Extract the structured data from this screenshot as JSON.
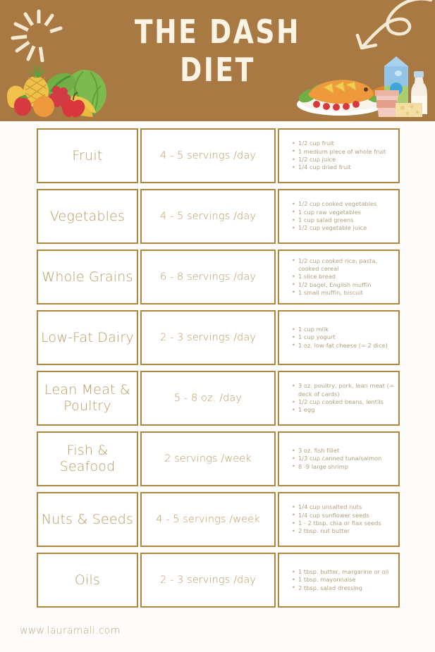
{
  "header": {
    "title_line1": "THE DASH",
    "title_line2": "DIET",
    "background_color": "#A87943",
    "title_color": "#FBF3E4",
    "decorations": {
      "sunburst": "sunburst-icon",
      "curly_arrow": "curly-arrow-icon",
      "fruit_cluster": "fruit-vegetables-illustration",
      "dairy_cluster": "fish-dairy-illustration"
    }
  },
  "table": {
    "accent_color": "#B0853F",
    "text_color": "#B89A60",
    "bullet_text_color": "#B0A07C",
    "rows": [
      {
        "name": "Fruit",
        "servings": "4 - 5 servings /day",
        "examples": [
          "1/2 cup fruit",
          "1 medium piece of whole fruit",
          "1/2 cup juice",
          "1/4 cup dried fruit"
        ]
      },
      {
        "name": "Vegetables",
        "servings": "4 - 5 servings /day",
        "examples": [
          "1/2 cup cooked vegetables",
          "1 cup raw vegetables",
          "1 cup salad greens",
          "1/2 cup vegetable juice"
        ]
      },
      {
        "name": "Whole Grains",
        "servings": "6 - 8 servings /day",
        "examples": [
          "1/2 cup cooked rice, pasta, cooked cereal",
          "1 slice bread",
          "1/2 bagel, English muffin",
          "1 small muffin, biscuit"
        ]
      },
      {
        "name": "Low-Fat Dairy",
        "servings": "2 - 3 servings /day",
        "examples": [
          "1 cup milk",
          "1 cup yogurt",
          "1 oz. low-fat cheese (= 2 dice)"
        ]
      },
      {
        "name": "Lean Meat & Poultry",
        "servings": "5 - 8 oz. /day",
        "examples": [
          " 3 oz. poultry, pork, lean meat (= deck of cards)",
          "1/2 cup cooked beans, lentils",
          "1 egg"
        ]
      },
      {
        "name": "Fish & Seafood",
        "servings": "2 servings /week",
        "examples": [
          " 3 oz. fish fillet",
          "1/3 cup canned tuna/salmon",
          "8 -9 large shrimp"
        ]
      },
      {
        "name": "Nuts & Seeds",
        "servings": "4 - 5 servings /week",
        "examples": [
          "1/4 cup unsalted nuts",
          "1/4 cup sunflower seeds",
          "1 - 2 tbsp. chia or flax seeds",
          "2 tbsp. nut butter"
        ]
      },
      {
        "name": "Oils",
        "servings": "2 - 3 servings /day",
        "examples": [
          "1 tbsp. butter, margarine or oil",
          "1 tbsp. mayonnaise",
          "2 tbsp. salad dressing"
        ]
      }
    ]
  },
  "footer": {
    "website": "www.lauramali.com"
  }
}
